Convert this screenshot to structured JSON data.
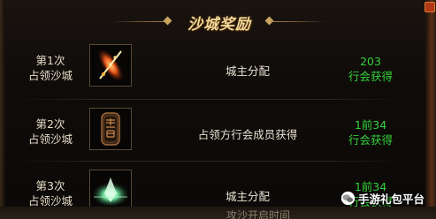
{
  "panel": {
    "title": "沙城奖励"
  },
  "rewards": [
    {
      "rank_line1": "第1次",
      "rank_line2": "占领沙城",
      "item_icon": "flame-sword-icon",
      "distribution": "城主分配",
      "reward_line1": "203",
      "reward_line2": "行会获得"
    },
    {
      "rank_line1": "第2次",
      "rank_line2": "占领沙城",
      "item_icon": "sand-city-token-icon",
      "distribution": "占领方行会成员获得",
      "reward_line1": "1前34",
      "reward_line2": "行会获得"
    },
    {
      "rank_line1": "第3次",
      "rank_line2": "占领沙城",
      "item_icon": "glowing-crystal-icon",
      "distribution": "城主分配",
      "reward_line1": "1前34",
      "reward_line2": "行会获得"
    }
  ],
  "footer": {
    "text": "攻沙开启时间"
  },
  "watermark": {
    "text": "手游礼包平台"
  },
  "colors": {
    "title": "#f0d79a",
    "reward_text": "#34d13a",
    "body_text": "#e8e2d2",
    "background": "#0e0b09"
  }
}
